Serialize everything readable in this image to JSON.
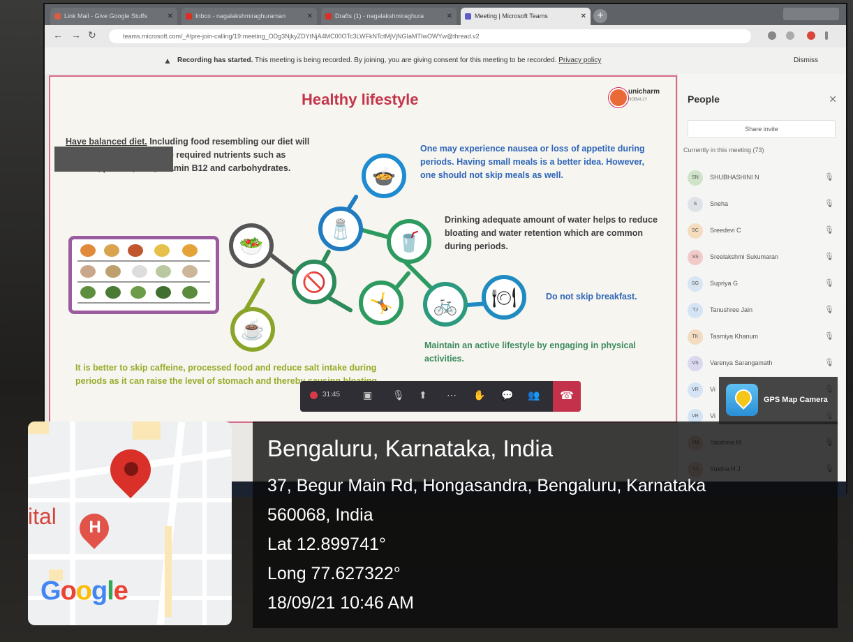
{
  "browser": {
    "tabs": [
      {
        "label": "Link Mail - Give Google Stuffs",
        "favicon_color": "#d95c45"
      },
      {
        "label": "Inbox - nagalakshmiraghuraman",
        "favicon_color": "#d93025"
      },
      {
        "label": "Drafts (1) - nagalakshmiraghura",
        "favicon_color": "#d93025"
      },
      {
        "label": "Meeting | Microsoft Teams",
        "favicon_color": "#5b5fc7"
      }
    ],
    "url": "teams.microsoft.com/_#/pre-join-calling/19:meeting_ODg3NjkyZDYtNjA4MC00OTc3LWFkNTctMjVjNGIaMTIwOWYw@thread.v2",
    "back_icon": "arrow-left-icon",
    "forward_icon": "arrow-right-icon",
    "reload_icon": "reload-icon"
  },
  "recording_banner": {
    "bold": "Recording has started.",
    "message": " This meeting is being recorded. By joining, you are giving consent for this meeting to be recorded. ",
    "privacy_link": "Privacy policy",
    "dismiss": "Dismiss"
  },
  "slide": {
    "title": "Healthy lifestyle",
    "logo_text": "unicharm",
    "logo_sub": "NOBALLY",
    "diet_text_underlined": "Have balanced diet.",
    "diet_text_rest": " Including food resembling our diet will ensure that you get all the required nutrients such as calcium, protein, iron, vitamin B12 and carbohydrates.",
    "nausea_text": "One may experience nausea or loss of appetite during periods. Having small meals is a better idea. However, one should not skip meals as well.",
    "water_text": "Drinking adequate amount of water helps to reduce bloating and water retention which are common during periods.",
    "breakfast_text": "Do not skip breakfast.",
    "active_text": "Maintain an active lifestyle by engaging in physical activities.",
    "caffeine_text": "It is better to skip caffeine, processed food and reduce salt intake during periods as it can raise the level of stomach and thereby causing bloating."
  },
  "call_controls": {
    "timer": "31:45",
    "icons": [
      "camera-off-icon",
      "mic-off-icon",
      "share-screen-icon",
      "more-icon",
      "raise-hand-icon",
      "chat-icon",
      "people-icon"
    ],
    "hangup_icon": "hang-up-icon"
  },
  "people_panel": {
    "title": "People",
    "share_invite": "Share invite",
    "currently": "Currently in this meeting (73)",
    "participants": [
      {
        "initials": "SN",
        "name": "SHUBHASHINI N",
        "color": "#cfe3c9"
      },
      {
        "initials": "S",
        "name": "Sneha",
        "color": "#dfe3e8"
      },
      {
        "initials": "SC",
        "name": "Sreedevi C",
        "color": "#f5dcbf"
      },
      {
        "initials": "SS",
        "name": "Sreelakshmi Sukumaran",
        "color": "#f2c9c9"
      },
      {
        "initials": "SG",
        "name": "Supriya G",
        "color": "#d8e4f1"
      },
      {
        "initials": "TJ",
        "name": "Tanushree Jain",
        "color": "#d4e4f4"
      },
      {
        "initials": "TK",
        "name": "Tasmiya Khanum",
        "color": "#f3dcc0"
      },
      {
        "initials": "VS",
        "name": "Varenya Sarangamath",
        "color": "#dad8ee"
      },
      {
        "initials": "VR",
        "name": "Vi",
        "color": "#d4e4f4"
      },
      {
        "initials": "VR",
        "name": "Vi",
        "color": "#d4e4f4"
      },
      {
        "initials": "YM",
        "name": "Yatahina M",
        "color": "#f2c9c9"
      },
      {
        "initials": "YJ",
        "name": "Yuktha H J",
        "color": "#f2c9c9"
      }
    ]
  },
  "gps": {
    "badge_label": "GPS Map Camera",
    "city": "Bengaluru, Karnataka, India",
    "address_line1": "37, Begur Main Rd, Hongasandra, Bengaluru, Karnataka",
    "address_line2": "560068, India",
    "lat": "Lat 12.899741°",
    "long": "Long 77.627322°",
    "datetime": "18/09/21 10:46 AM",
    "map_label": "ital",
    "hospital_letter": "H",
    "google_text": "Google"
  }
}
